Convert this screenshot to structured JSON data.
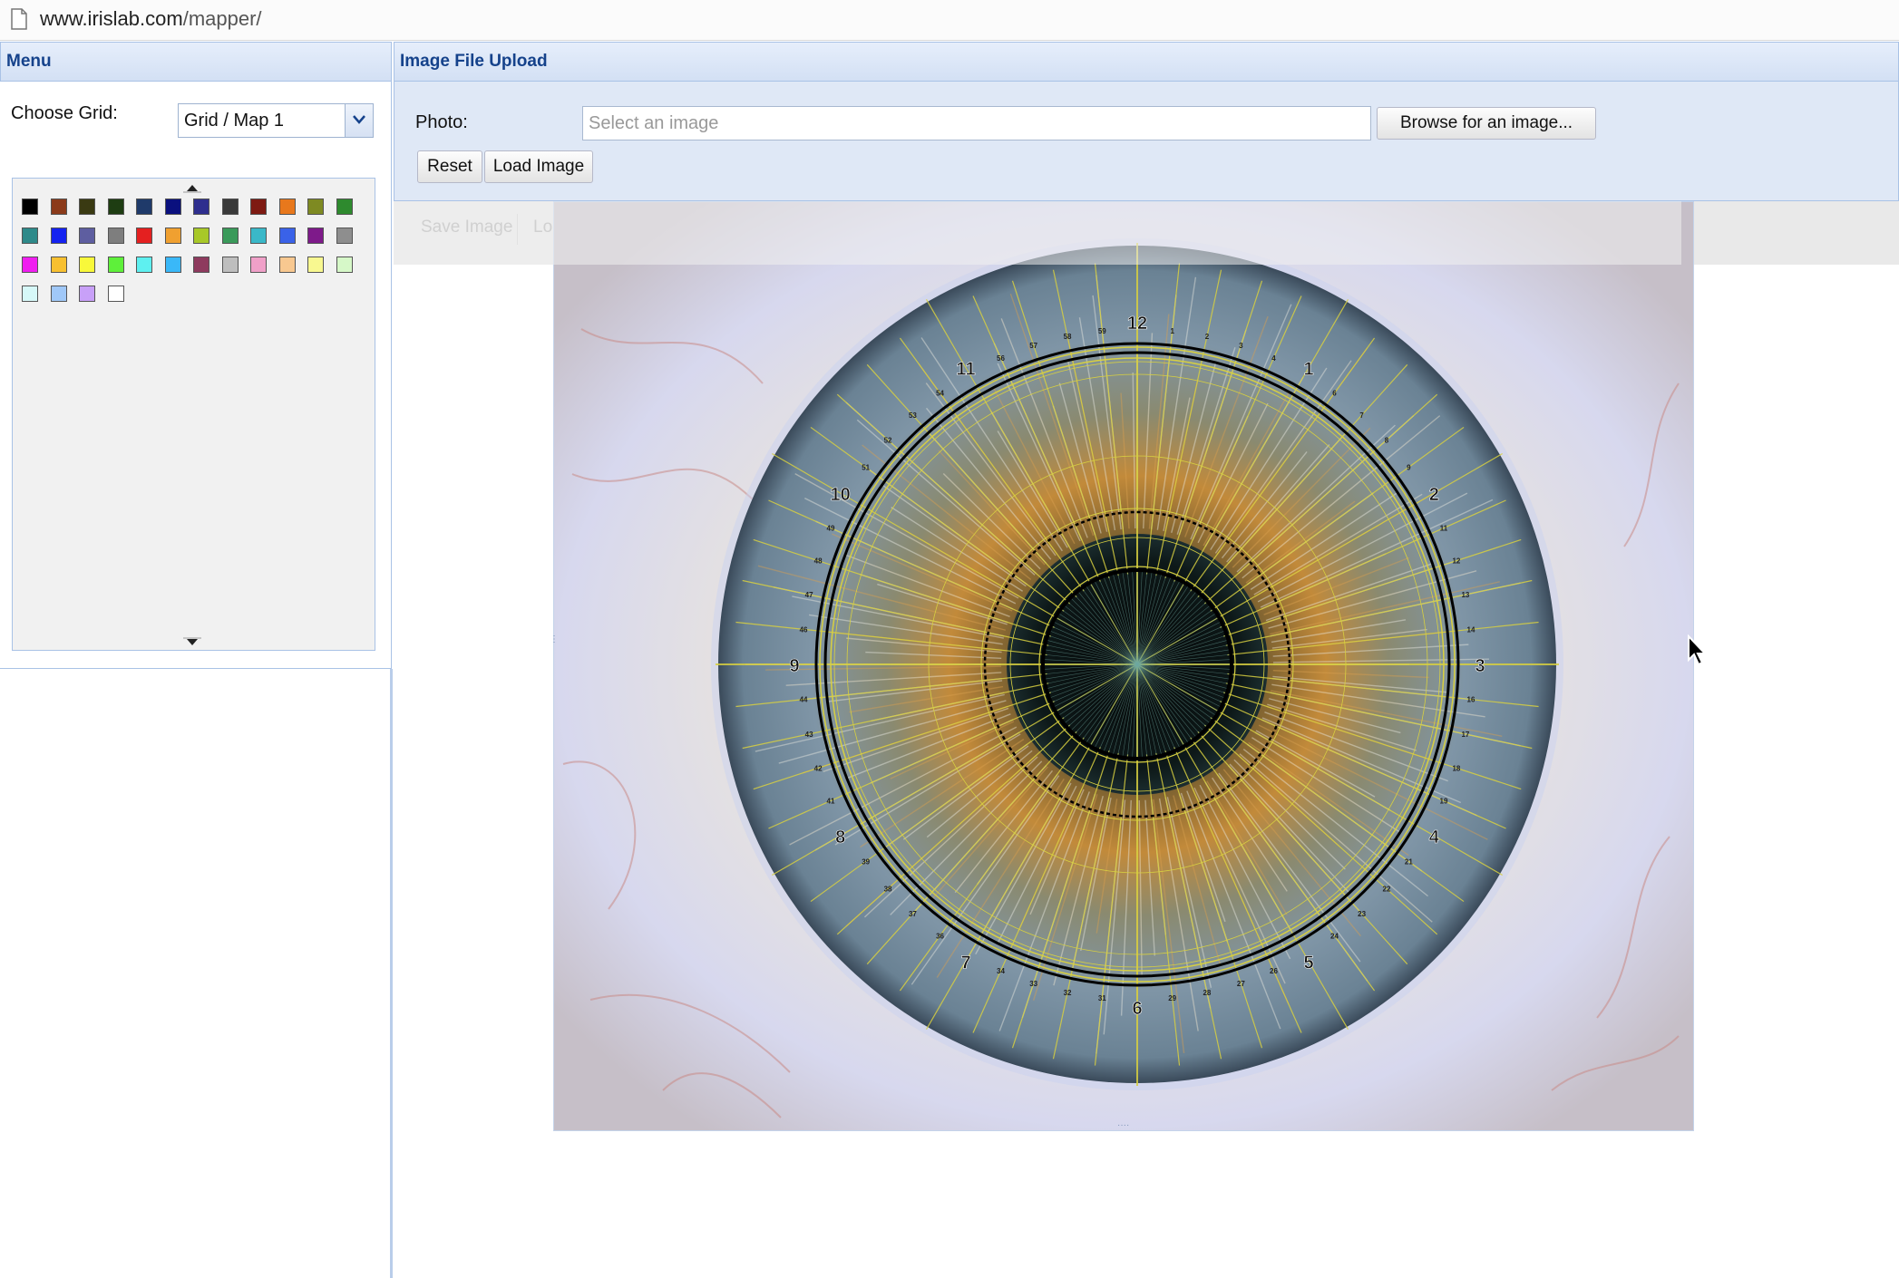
{
  "browser": {
    "url_domain": "www.irislab.com",
    "url_path": "/mapper/"
  },
  "menu_panel": {
    "title": "Menu",
    "choose_grid_label": "Choose Grid:",
    "grid_select_value": "Grid / Map 1",
    "palette_colors": [
      "#000000",
      "#8b3a1a",
      "#3a3a12",
      "#1e3d12",
      "#1f3a6a",
      "#0a107e",
      "#2e2e8e",
      "#3a3a3a",
      "#7e1a12",
      "#e8781c",
      "#7e8a22",
      "#2e8a2e",
      "#2e8a8a",
      "#1422f0",
      "#5e5ea0",
      "#7e7e7e",
      "#e42020",
      "#f0a030",
      "#a8c828",
      "#3a9a5a",
      "#3ab8c8",
      "#3a62e8",
      "#7e1a8a",
      "#8e8e8e",
      "#f01ef0",
      "#f8c030",
      "#f8f83a",
      "#5ef03a",
      "#5ef0f0",
      "#3ab8f8",
      "#8e3a5e",
      "#bebebe",
      "#f0a0c8",
      "#f8c890",
      "#f8f890",
      "#d6f8c8",
      "#d6f8f8",
      "#a0c8f8",
      "#c8a0f8",
      "#ffffff"
    ]
  },
  "upload_panel": {
    "title": "Image File Upload",
    "photo_label": "Photo:",
    "photo_placeholder": "Select an image",
    "browse_button": "Browse for an image...",
    "reset_button": "Reset",
    "load_button": "Load Image"
  },
  "image_toolbar": {
    "save_button": "Save Image",
    "lock_button": "Lock"
  },
  "iris_chart": {
    "hour_labels": [
      "12",
      "1",
      "2",
      "3",
      "4",
      "5",
      "6",
      "7",
      "8",
      "9",
      "10",
      "11"
    ],
    "minute_labels": [
      "1",
      "2",
      "3",
      "4",
      "6",
      "7",
      "8",
      "9",
      "11",
      "12",
      "13",
      "14",
      "16",
      "17",
      "18",
      "19",
      "21",
      "22",
      "23",
      "24",
      "26",
      "27",
      "28",
      "29",
      "31",
      "32",
      "33",
      "34",
      "36",
      "37",
      "38",
      "39",
      "41",
      "42",
      "43",
      "44",
      "46",
      "47",
      "48",
      "49",
      "51",
      "52",
      "53",
      "54",
      "56",
      "57",
      "58",
      "59"
    ]
  }
}
